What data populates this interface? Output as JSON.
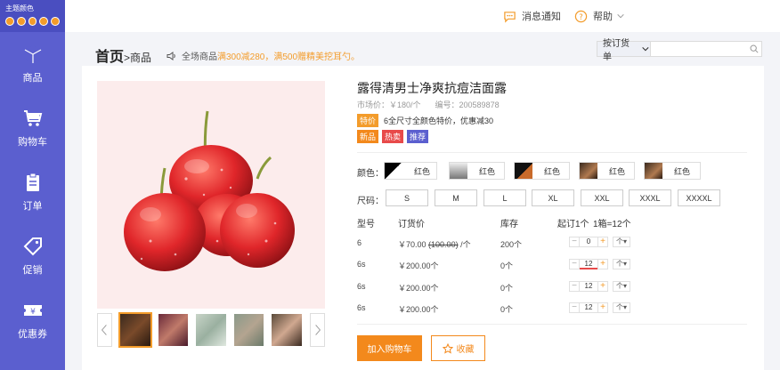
{
  "theme": {
    "label": "主题颜色",
    "dot_color": "#f39c2b"
  },
  "sidebar": {
    "bg": "#5b5fcf",
    "items": [
      {
        "label": "商品",
        "icon": "cube-icon",
        "active": true
      },
      {
        "label": "购物车",
        "icon": "cart-icon",
        "active": false
      },
      {
        "label": "订单",
        "icon": "order-clipboard-icon",
        "active": false
      },
      {
        "label": "促销",
        "icon": "tag-icon",
        "active": false
      },
      {
        "label": "优惠券",
        "icon": "coupon-icon",
        "active": false
      }
    ]
  },
  "topbar": {
    "notify": "消息通知",
    "help": "帮助"
  },
  "breadcrumb": {
    "home": "首页",
    "separator": ">",
    "current": "商品"
  },
  "notice": {
    "prefix": "全场商品",
    "hl1": "满300减280，",
    "hl2": "满500赠精美挖耳勺。"
  },
  "search": {
    "select": "按订货单",
    "placeholder": ""
  },
  "product": {
    "title": "露得清男士净爽抗痘洁面露",
    "market_price": "市场价：￥180/个",
    "code": "编号：200589878",
    "promo_badge": "特价",
    "promo_text": "6全尺寸全颜色特价，优惠减30",
    "tags": [
      {
        "label": "新品",
        "color": "#f3891c"
      },
      {
        "label": "热卖",
        "color": "#e84a4a"
      },
      {
        "label": "推荐",
        "color": "#5b5fcf"
      }
    ],
    "color_label": "颜色：",
    "colors": [
      "红色",
      "红色",
      "红色",
      "红色",
      "红色"
    ],
    "size_label": "尺码：",
    "sizes": [
      "S",
      "M",
      "L",
      "XL",
      "XXL",
      "XXXL",
      "XXXXL"
    ]
  },
  "table": {
    "headers": {
      "model": "型号",
      "price": "订货价",
      "stock": "库存",
      "moq": "起订1个",
      "box": "1箱=12个"
    },
    "rows": [
      {
        "model": "6",
        "price": "￥70.00",
        "orig": "(100.00)",
        "unit": "/个",
        "stock": "200个",
        "qty": "0"
      },
      {
        "model": "6s",
        "price": "￥200.00个",
        "orig": "",
        "unit": "",
        "stock": "0个",
        "qty": "12"
      },
      {
        "model": "6s",
        "price": "￥200.00个",
        "orig": "",
        "unit": "",
        "stock": "0个",
        "qty": "12"
      },
      {
        "model": "6s",
        "price": "￥200.00个",
        "orig": "",
        "unit": "",
        "stock": "0个",
        "qty": "12"
      }
    ],
    "unit_select": "个"
  },
  "actions": {
    "add_cart": "加入购物车",
    "favorite": "收藏"
  }
}
